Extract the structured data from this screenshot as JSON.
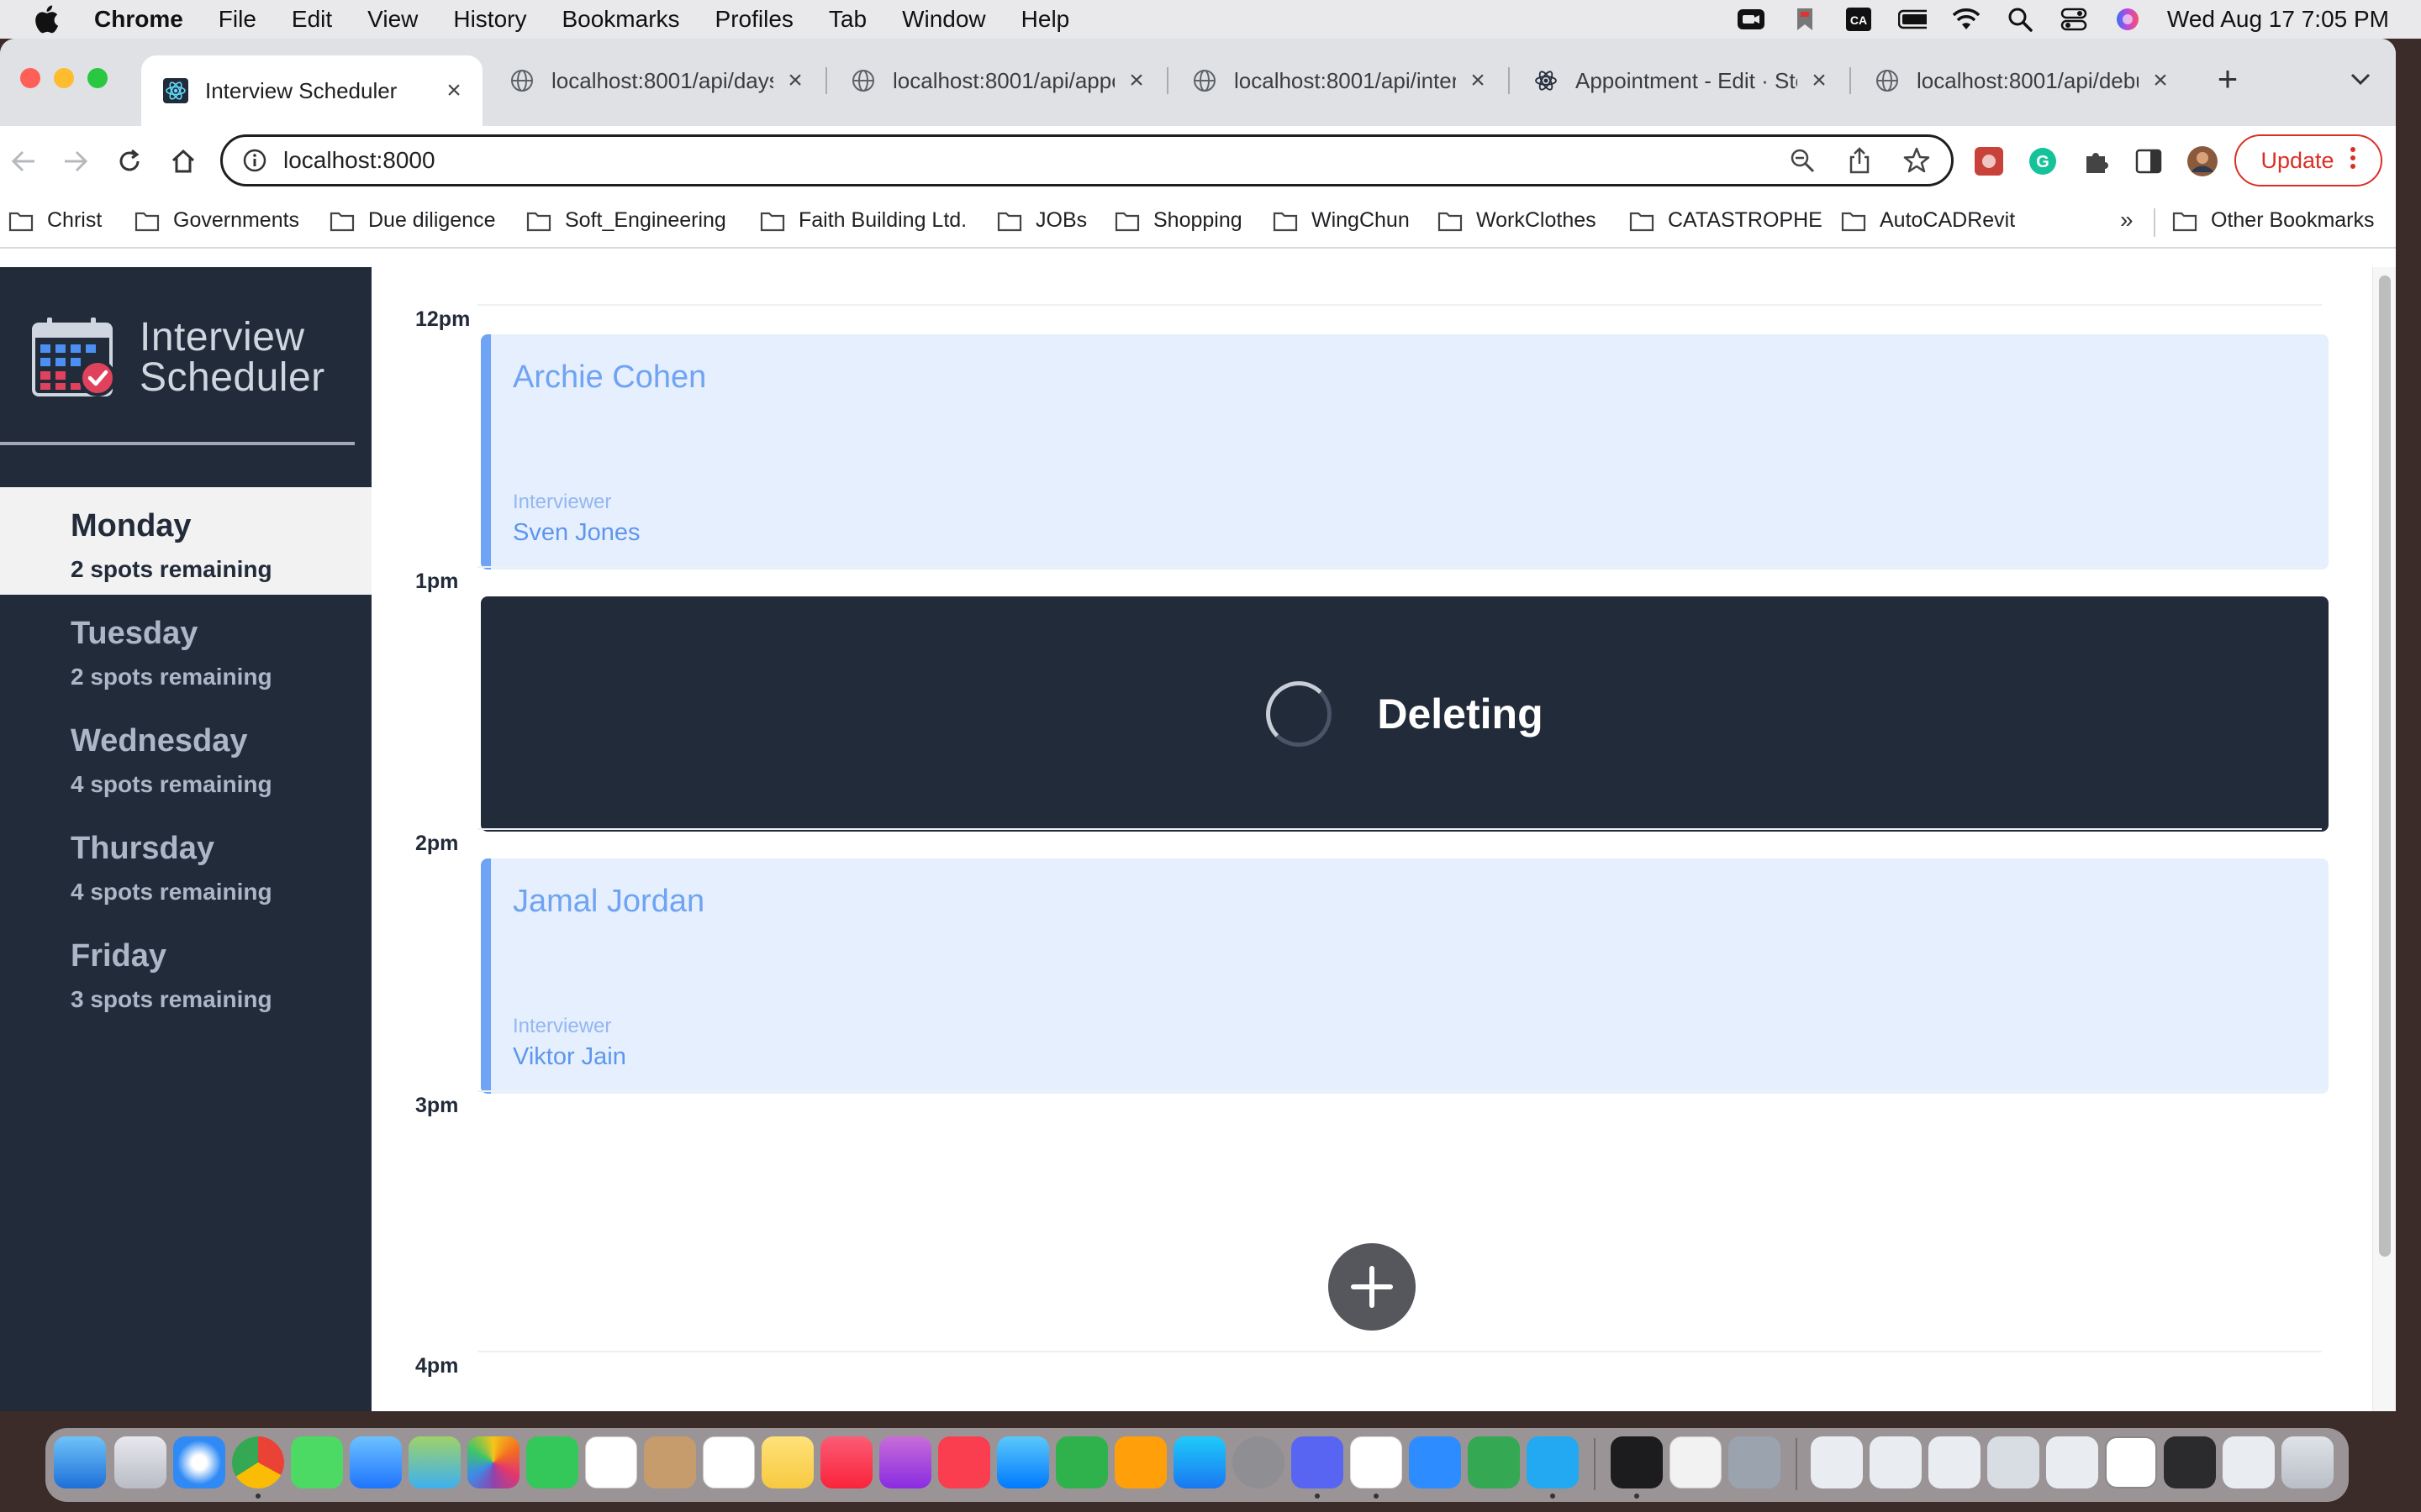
{
  "menubar": {
    "app_name": "Chrome",
    "items": [
      "File",
      "Edit",
      "View",
      "History",
      "Bookmarks",
      "Profiles",
      "Tab",
      "Window",
      "Help"
    ],
    "clock": "Wed Aug 17  7:05 PM"
  },
  "browser": {
    "tabs": [
      {
        "title": "Interview Scheduler",
        "favicon": "react-icon",
        "active": true
      },
      {
        "title": "localhost:8001/api/days",
        "favicon": "globe-icon",
        "active": false
      },
      {
        "title": "localhost:8001/api/appoi",
        "favicon": "globe-icon",
        "active": false
      },
      {
        "title": "localhost:8001/api/interv",
        "favicon": "globe-icon",
        "active": false
      },
      {
        "title": "Appointment - Edit · Sto",
        "favicon": "react-icon",
        "active": false
      },
      {
        "title": "localhost:8001/api/debu",
        "favicon": "globe-icon",
        "active": false
      }
    ],
    "url": "localhost:8000",
    "update_label": "Update",
    "bookmarks": [
      "Christ",
      "Governments",
      "Due diligence",
      "Soft_Engineering",
      "Faith Building Ltd.",
      "JOBs",
      "Shopping",
      "WingChun",
      "WorkClothes",
      "CATASTROPHE",
      "AutoCADRevit"
    ],
    "bookmarks_more": "»",
    "other_bookmarks": "Other Bookmarks"
  },
  "app": {
    "logo_line1": "Interview",
    "logo_line2": "Scheduler",
    "days": [
      {
        "name": "Monday",
        "spots": "2 spots remaining",
        "selected": true
      },
      {
        "name": "Tuesday",
        "spots": "2 spots remaining",
        "selected": false
      },
      {
        "name": "Wednesday",
        "spots": "4 spots remaining",
        "selected": false
      },
      {
        "name": "Thursday",
        "spots": "4 spots remaining",
        "selected": false
      },
      {
        "name": "Friday",
        "spots": "3 spots remaining",
        "selected": false
      }
    ],
    "times": [
      "12pm",
      "1pm",
      "2pm",
      "3pm",
      "4pm"
    ],
    "appointments": [
      {
        "student": "Archie Cohen",
        "interviewer_label": "Interviewer",
        "interviewer": "Sven Jones"
      },
      {
        "status": "Deleting"
      },
      {
        "student": "Jamal Jordan",
        "interviewer_label": "Interviewer",
        "interviewer": "Viktor Jain"
      }
    ]
  },
  "colors": {
    "sidebar_bg": "#222b39",
    "appointment_bg": "#e6effd",
    "appointment_accent": "#6fa3f3",
    "update_red": "#d93025"
  }
}
